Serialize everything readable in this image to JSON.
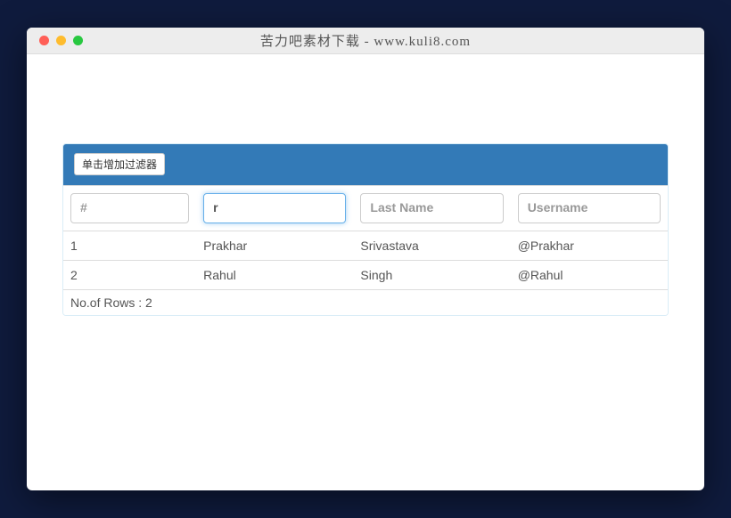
{
  "window": {
    "title": "苦力吧素材下载 - www.kuli8.com"
  },
  "panel": {
    "add_filter_button": "单击增加过滤器"
  },
  "filters": {
    "id": {
      "placeholder": "#",
      "value": ""
    },
    "first_name": {
      "placeholder": "",
      "value": "r"
    },
    "last_name": {
      "placeholder": "Last Name",
      "value": ""
    },
    "username": {
      "placeholder": "Username",
      "value": ""
    }
  },
  "rows": [
    {
      "id": "1",
      "first_name": "Prakhar",
      "last_name": "Srivastava",
      "username": "@Prakhar"
    },
    {
      "id": "2",
      "first_name": "Rahul",
      "last_name": "Singh",
      "username": "@Rahul"
    }
  ],
  "footer": {
    "row_count_label": "No.of Rows : 2"
  }
}
